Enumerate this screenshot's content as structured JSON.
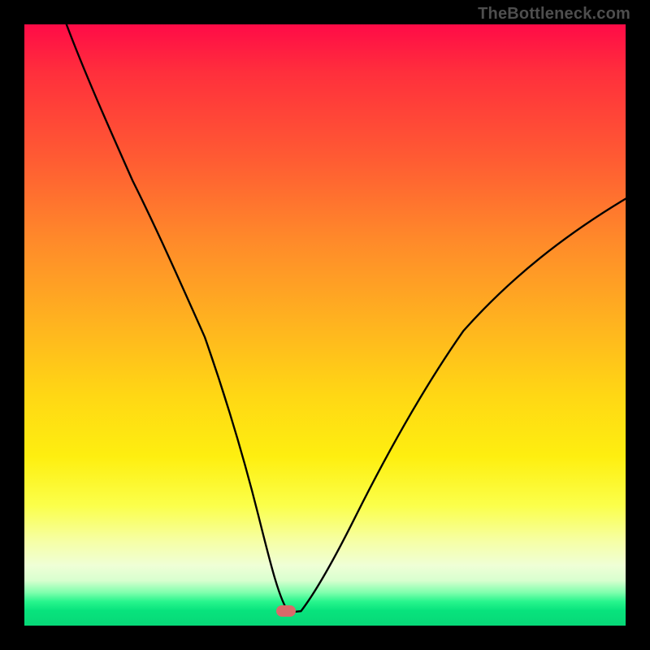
{
  "watermark": "TheBottleneck.com",
  "marker": {
    "color": "#d96a6a",
    "x_pct": 43.5,
    "y_pct": 97.6
  },
  "chart_data": {
    "type": "line",
    "title": "",
    "xlabel": "",
    "ylabel": "",
    "xlim": [
      0,
      100
    ],
    "ylim": [
      0,
      100
    ],
    "series": [
      {
        "name": "curve",
        "x": [
          7,
          10,
          14,
          18,
          22,
          26,
          30,
          33.5,
          36.5,
          39,
          41,
          42.5,
          44,
          46,
          48,
          51,
          55,
          60,
          66,
          73,
          81,
          90,
          100
        ],
        "y": [
          100,
          92,
          83,
          74,
          66,
          57,
          48,
          38,
          28,
          18,
          10,
          4,
          2.2,
          2.4,
          5,
          10,
          18,
          28,
          39,
          49,
          58,
          65,
          71
        ]
      }
    ],
    "background_gradient": {
      "direction": "vertical",
      "stops": [
        {
          "pos": 0.0,
          "color": "#ff0b47"
        },
        {
          "pos": 0.22,
          "color": "#ff5a33"
        },
        {
          "pos": 0.5,
          "color": "#ffb41f"
        },
        {
          "pos": 0.72,
          "color": "#feef10"
        },
        {
          "pos": 0.9,
          "color": "#efffd6"
        },
        {
          "pos": 0.96,
          "color": "#28f58d"
        },
        {
          "pos": 1.0,
          "color": "#07d877"
        }
      ]
    },
    "marker_point": {
      "x": 43.5,
      "y": 2.4
    }
  }
}
